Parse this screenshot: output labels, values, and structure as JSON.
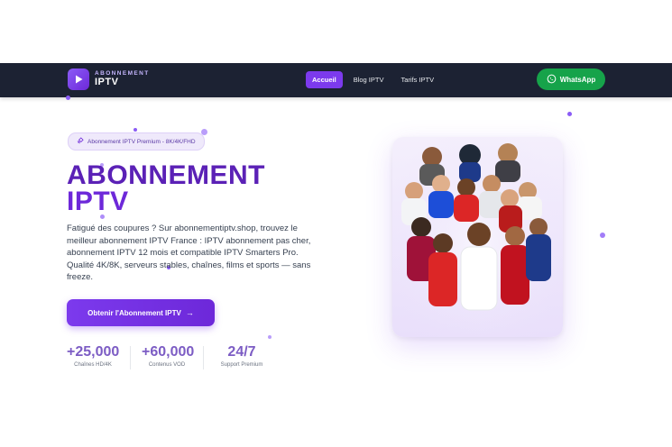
{
  "nav": {
    "logo_top": "ABONNEMENT",
    "logo_bottom": "IPTV",
    "links": [
      {
        "label": "Accueil",
        "active": true
      },
      {
        "label": "Blog IPTV",
        "active": false
      },
      {
        "label": "Tarifs IPTV",
        "active": false
      }
    ],
    "whatsapp_label": "WhatsApp"
  },
  "hero": {
    "badge": "Abonnement IPTV Premium - 8K/4K/FHD",
    "title_line1": "ABONNEMENT",
    "title_line2": "IPTV",
    "description": "Fatigué des coupures ? Sur abonnementiptv.shop, trouvez le meilleur abonnement IPTV France : IPTV abonnement pas cher, abonnement IPTV 12 mois et compatible IPTV Smarters Pro. Qualité 4K/8K, serveurs stables, chaînes, films et sports — sans freeze.",
    "cta_label": "Obtenir l'Abonnement IPTV",
    "cta_arrow": "→"
  },
  "stats": [
    {
      "value": "+25,000",
      "label": "Chaînes HD/4K"
    },
    {
      "value": "+60,000",
      "label": "Contenus VOD"
    },
    {
      "value": "24/7",
      "label": "Support Premium"
    }
  ],
  "colors": {
    "nav_bg": "#1c2233",
    "accent": "#7c3aed",
    "whatsapp": "#16a34a",
    "title": "#5b21b6"
  },
  "icons": {
    "logo": "play-icon",
    "whatsapp": "whatsapp-icon",
    "badge": "satellite-icon",
    "cta": "arrow-right-icon"
  }
}
